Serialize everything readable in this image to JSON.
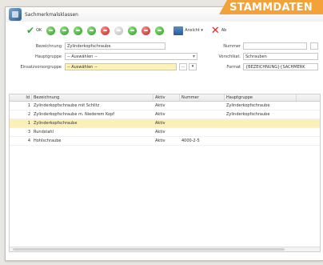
{
  "badge": "STAMMDATEN",
  "window": {
    "title": "Sachmerkmalsklassen"
  },
  "toolbar": {
    "ok_label": "OK",
    "view_label": "Ansicht ▾",
    "cut_label": "Ab"
  },
  "form": {
    "bezeichnung_label": "Bezeichnung",
    "bezeichnung_value": "Zylinderkopfschraube",
    "hauptgruppe_label": "Hauptgruppe",
    "hauptgruppe_value": "-- Auswählen --",
    "einsatzgruppe_label": "Einsatzvorsorgruppe",
    "einsatzgruppe_value": "-- Auswählen --",
    "nummer_label": "Nummer",
    "nummer_value": "",
    "vorschlag_label": "Vorschlkat.",
    "vorschlag_value": "Schrauben",
    "format_label": "Format",
    "format_value": "{BEZEICHNUNG}{SACHMERK"
  },
  "grid": {
    "columns": [
      "Id",
      "Bezeichnung",
      "Aktiv",
      "Nummer",
      "Hauptgruppe"
    ],
    "rows": [
      [
        "1",
        "Zylinderkopfschraube mit Schlitz",
        "Aktiv",
        "",
        "Zylinderkopfschraube"
      ],
      [
        "2",
        "Zylinderkopfschraube m. Niederem Kopf",
        "Aktiv",
        "",
        "Zylinderkopfschraube"
      ],
      [
        "1",
        "Zylinderkopfschraube",
        "Aktiv",
        "",
        ""
      ],
      [
        "3",
        "Rundstahl",
        "Aktiv",
        "",
        ""
      ],
      [
        "4",
        "Hohlschraube",
        "Aktiv",
        "4000-2-5",
        ""
      ]
    ],
    "selected_row": 2
  }
}
